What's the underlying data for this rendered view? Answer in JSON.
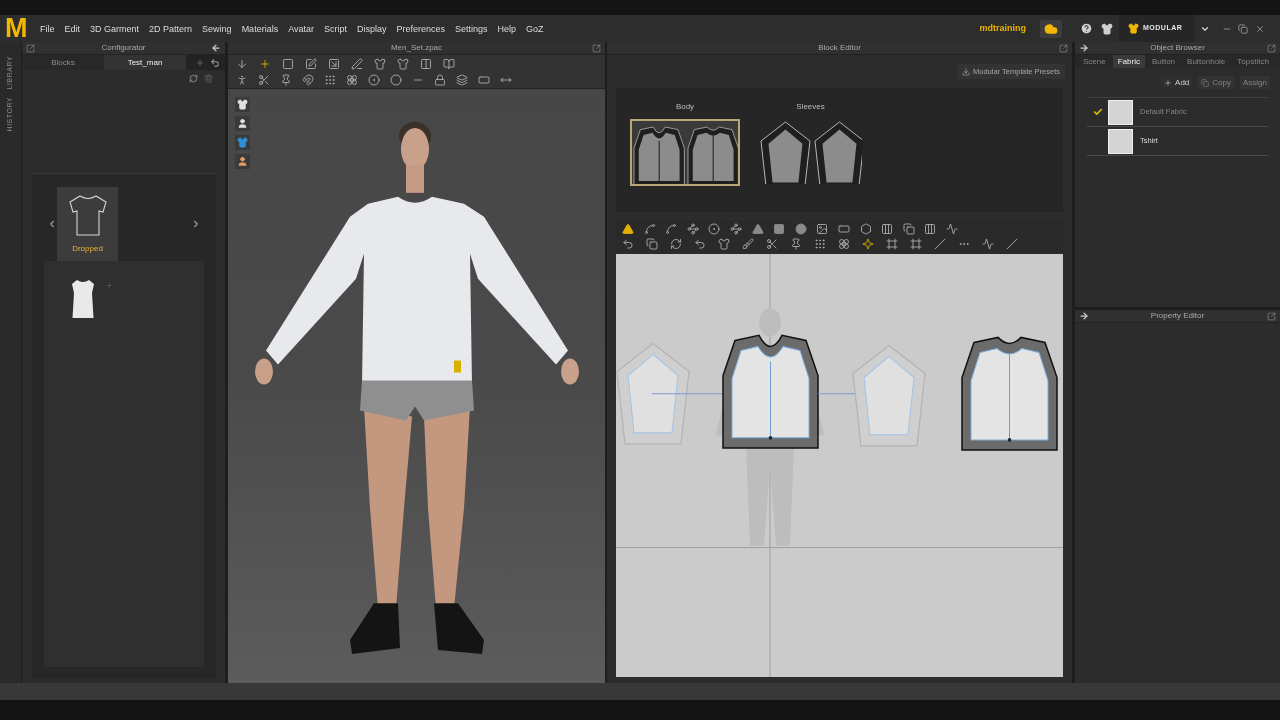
{
  "app": {
    "logo": "M"
  },
  "menu": [
    "File",
    "Edit",
    "3D Garment",
    "2D Pattern",
    "Sewing",
    "Materials",
    "Avatar",
    "Script",
    "Display",
    "Preferences",
    "Settings",
    "Help",
    "GoZ"
  ],
  "account": {
    "user": "mdtraining",
    "mode": "MODULAR"
  },
  "side_tabs": [
    "LIBRARY",
    "HISTORY"
  ],
  "configurator": {
    "title": "Configurator",
    "tabs": [
      {
        "label": "Blocks",
        "selected": false
      },
      {
        "label": "Test_man",
        "selected": true
      }
    ],
    "styles": [
      {
        "label": "Dropped",
        "selected": true
      }
    ]
  },
  "viewport": {
    "title": "Men_Set.zpac"
  },
  "block_editor": {
    "title": "Block Editor",
    "presets_button": "Modular Template Presets",
    "blocks": [
      {
        "label": "Body",
        "kind": "body",
        "selected": true
      },
      {
        "label": "Sleeves",
        "kind": "sleeve",
        "selected": false
      }
    ]
  },
  "object_browser": {
    "title": "Object Browser",
    "tabs": [
      {
        "label": "Scene",
        "selected": false
      },
      {
        "label": "Fabric",
        "selected": true
      },
      {
        "label": "Button",
        "selected": false
      },
      {
        "label": "Buttonhole",
        "selected": false
      },
      {
        "label": "Topstitch",
        "selected": false
      }
    ],
    "actions": [
      {
        "label": "Add",
        "kind": "add",
        "disabled": false
      },
      {
        "label": "Copy",
        "kind": "copy",
        "disabled": true
      },
      {
        "label": "Assign",
        "kind": "assign",
        "disabled": true
      }
    ],
    "fabrics": [
      {
        "name": "Default Fabric",
        "checked": true,
        "disabled": true
      },
      {
        "name": "Tshirt",
        "checked": false,
        "disabled": false
      }
    ]
  },
  "property_editor": {
    "title": "Property Editor"
  }
}
